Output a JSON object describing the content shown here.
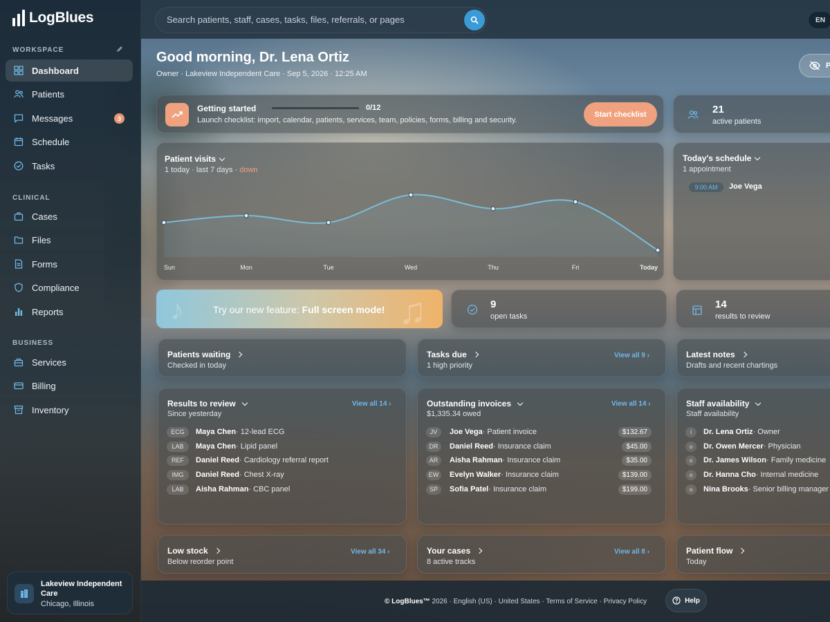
{
  "brand": {
    "name": "LogBlues"
  },
  "sidebar": {
    "workspace_label": "WORKSPACE",
    "clinical_label": "CLINICAL",
    "business_label": "BUSINESS",
    "workspace": [
      {
        "label": "Dashboard",
        "icon": "grid-icon",
        "active": true
      },
      {
        "label": "Patients",
        "icon": "users-icon"
      },
      {
        "label": "Messages",
        "icon": "message-icon",
        "badge": "3"
      },
      {
        "label": "Schedule",
        "icon": "calendar-icon"
      },
      {
        "label": "Tasks",
        "icon": "check-circle-icon"
      }
    ],
    "clinical": [
      {
        "label": "Cases",
        "icon": "briefcase-icon"
      },
      {
        "label": "Files",
        "icon": "folder-icon"
      },
      {
        "label": "Forms",
        "icon": "document-icon"
      },
      {
        "label": "Compliance",
        "icon": "shield-icon"
      },
      {
        "label": "Reports",
        "icon": "bar-chart-icon"
      }
    ],
    "business": [
      {
        "label": "Services",
        "icon": "bag-icon"
      },
      {
        "label": "Billing",
        "icon": "credit-card-icon"
      },
      {
        "label": "Inventory",
        "icon": "archive-icon"
      }
    ],
    "org": {
      "name": "Lakeview Independent Care",
      "location": "Chicago, Illinois"
    }
  },
  "topbar": {
    "search_placeholder": "Search patients, staff, cases, tasks, files, referrals, or pages",
    "language": "EN"
  },
  "header": {
    "greeting": "Good morning, Dr. Lena Ortiz",
    "subline": "Owner · Lakeview Independent Care · Sep 5, 2026 · 12:25 AM",
    "privacy_label": "Pr"
  },
  "getting_started": {
    "title": "Getting started",
    "progress": "0/12",
    "progress_fraction": 0,
    "description": "Launch checklist: import, calendar, patients, services, team, policies, forms, billing and security.",
    "button": "Start checklist"
  },
  "stats": {
    "active_patients": {
      "value": "21",
      "label": "active patients"
    },
    "open_tasks": {
      "value": "9",
      "label": "open tasks"
    },
    "results_review": {
      "value": "14",
      "label": "results to review"
    }
  },
  "patient_visits": {
    "title": "Patient visits",
    "sub_prefix": "1 today · last 7 days · ",
    "trend": "down",
    "trend_color": "#f0a27f"
  },
  "chart_data": {
    "type": "line",
    "categories": [
      "Sun",
      "Mon",
      "Tue",
      "Wed",
      "Thu",
      "Fri",
      "Today"
    ],
    "values": [
      5,
      6,
      5,
      9,
      7,
      8,
      1
    ],
    "title": "Patient visits",
    "xlabel": "",
    "ylabel": "",
    "ylim": [
      0,
      11
    ],
    "grid": false,
    "line_color": "#7bbcd9"
  },
  "schedule": {
    "title": "Today's schedule",
    "sub": "1 appointment",
    "items": [
      {
        "time": "9:00 AM",
        "name": "Joe Vega"
      }
    ]
  },
  "promo": {
    "prefix": "Try our new feature: ",
    "highlight": "Full screen mode!"
  },
  "patients_waiting": {
    "title": "Patients waiting",
    "sub": "Checked in today"
  },
  "tasks_due": {
    "title": "Tasks due",
    "sub": "1 high priority",
    "view_all": "View all 9"
  },
  "latest_notes": {
    "title": "Latest notes",
    "sub": "Drafts and recent chartings"
  },
  "results": {
    "title": "Results to review",
    "sub": "Since yesterday",
    "view_all": "View all 14",
    "rows": [
      {
        "tag": "ECG",
        "name": "Maya Chen",
        "detail": " · 12-lead ECG"
      },
      {
        "tag": "LAB",
        "name": "Maya Chen",
        "detail": " · Lipid panel"
      },
      {
        "tag": "REF",
        "name": "Daniel Reed",
        "detail": " · Cardiology referral report"
      },
      {
        "tag": "IMG",
        "name": "Daniel Reed",
        "detail": " · Chest X-ray"
      },
      {
        "tag": "LAB",
        "name": "Aisha Rahman",
        "detail": " · CBC panel"
      }
    ]
  },
  "invoices": {
    "title": "Outstanding invoices",
    "sub": "$1,335.34 owed",
    "view_all": "View all 14",
    "rows": [
      {
        "initials": "JV",
        "name": "Joe Vega",
        "detail": " · Patient invoice",
        "amount": "$132.67"
      },
      {
        "initials": "DR",
        "name": "Daniel Reed",
        "detail": " · Insurance claim",
        "amount": "$45.00"
      },
      {
        "initials": "AR",
        "name": "Aisha Rahman",
        "detail": " · Insurance claim",
        "amount": "$35.00"
      },
      {
        "initials": "EW",
        "name": "Evelyn Walker",
        "detail": " · Insurance claim",
        "amount": "$139.00"
      },
      {
        "initials": "SP",
        "name": "Sofia Patel",
        "detail": " · Insurance claim",
        "amount": "$199.00"
      }
    ]
  },
  "staff": {
    "title": "Staff availability",
    "sub": "Staff availability",
    "rows": [
      {
        "initial": "l",
        "name": "Dr. Lena Ortiz",
        "detail": " · Owner"
      },
      {
        "initial": "o",
        "name": "Dr. Owen Mercer",
        "detail": " · Physician"
      },
      {
        "initial": "o",
        "name": "Dr. James Wilson",
        "detail": " · Family medicine"
      },
      {
        "initial": "o",
        "name": "Dr. Hanna Cho",
        "detail": " · Internal medicine"
      },
      {
        "initial": "o",
        "name": "Nina Brooks",
        "detail": " · Senior billing manager"
      }
    ]
  },
  "low_stock": {
    "title": "Low stock",
    "sub": "Below reorder point",
    "view_all": "View all 34"
  },
  "your_cases": {
    "title": "Your cases",
    "sub": "8 active tracks",
    "view_all": "View all 8"
  },
  "patient_flow": {
    "title": "Patient flow",
    "sub": "Today"
  },
  "footer": {
    "brand": "© LogBlues™",
    "text": " 2026 · English (US) · United States · Terms of Service · Privacy Policy",
    "help": "Help"
  }
}
